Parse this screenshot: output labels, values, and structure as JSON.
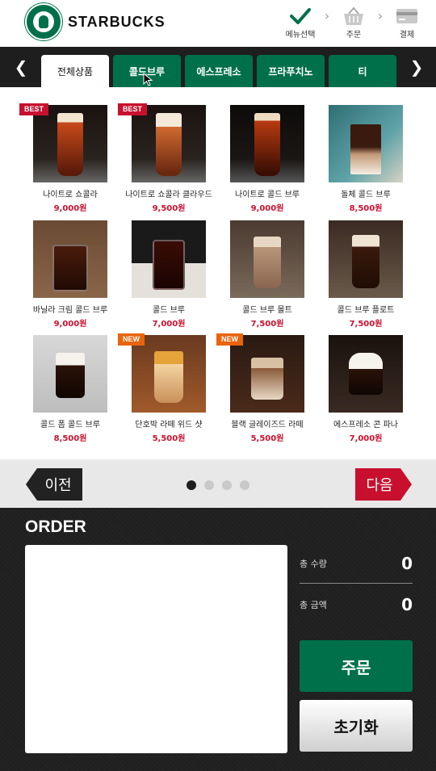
{
  "header": {
    "brand": "STARBUCKS",
    "steps": [
      {
        "label": "메뉴선택",
        "icon": "check-icon"
      },
      {
        "label": "주문",
        "icon": "basket-icon"
      },
      {
        "label": "결제",
        "icon": "card-icon"
      }
    ]
  },
  "categories": {
    "prev_icon": "chevron-left-icon",
    "next_icon": "chevron-right-icon",
    "tabs": [
      "전체상품",
      "콜드브루",
      "에스프레소",
      "프라푸치노",
      "티"
    ],
    "active": 0
  },
  "products": [
    {
      "name": "나이트로 쇼콜라",
      "price": "9,000원",
      "badge": "BEST"
    },
    {
      "name": "나이트로 쇼콜라 클라우드",
      "price": "9,500원",
      "badge": "BEST"
    },
    {
      "name": "나이트로 콜드 브루",
      "price": "9,000원",
      "badge": ""
    },
    {
      "name": "돌체 콜드 브루",
      "price": "8,500원",
      "badge": ""
    },
    {
      "name": "바닐라 크림 콜드 브루",
      "price": "9,000원",
      "badge": ""
    },
    {
      "name": "콜드 브루",
      "price": "7,000원",
      "badge": ""
    },
    {
      "name": "콜드 브루 몰트",
      "price": "7,500원",
      "badge": ""
    },
    {
      "name": "콜드 브루 플로트",
      "price": "7,500원",
      "badge": ""
    },
    {
      "name": "콜드 폼 콜드 브루",
      "price": "8,500원",
      "badge": ""
    },
    {
      "name": "단호박 라떼 위드 샷",
      "price": "5,500원",
      "badge": "NEW"
    },
    {
      "name": "블랙 글레이즈드 라떼",
      "price": "5,500원",
      "badge": "NEW"
    },
    {
      "name": "에스프레소 콘 파나",
      "price": "7,000원",
      "badge": ""
    }
  ],
  "pager": {
    "prev_label": "이전",
    "next_label": "다음",
    "page_count": 4,
    "current_page": 1
  },
  "order": {
    "title": "ORDER",
    "total_qty_label": "총 수량",
    "total_qty_value": "0",
    "total_price_label": "총 금액",
    "total_price_value": "0",
    "order_button": "주문",
    "reset_button": "초기화"
  },
  "colors": {
    "brand_green": "#00704a",
    "accent_red": "#c8102e",
    "badge_orange": "#e8650d",
    "dark": "#1e1e1e"
  }
}
